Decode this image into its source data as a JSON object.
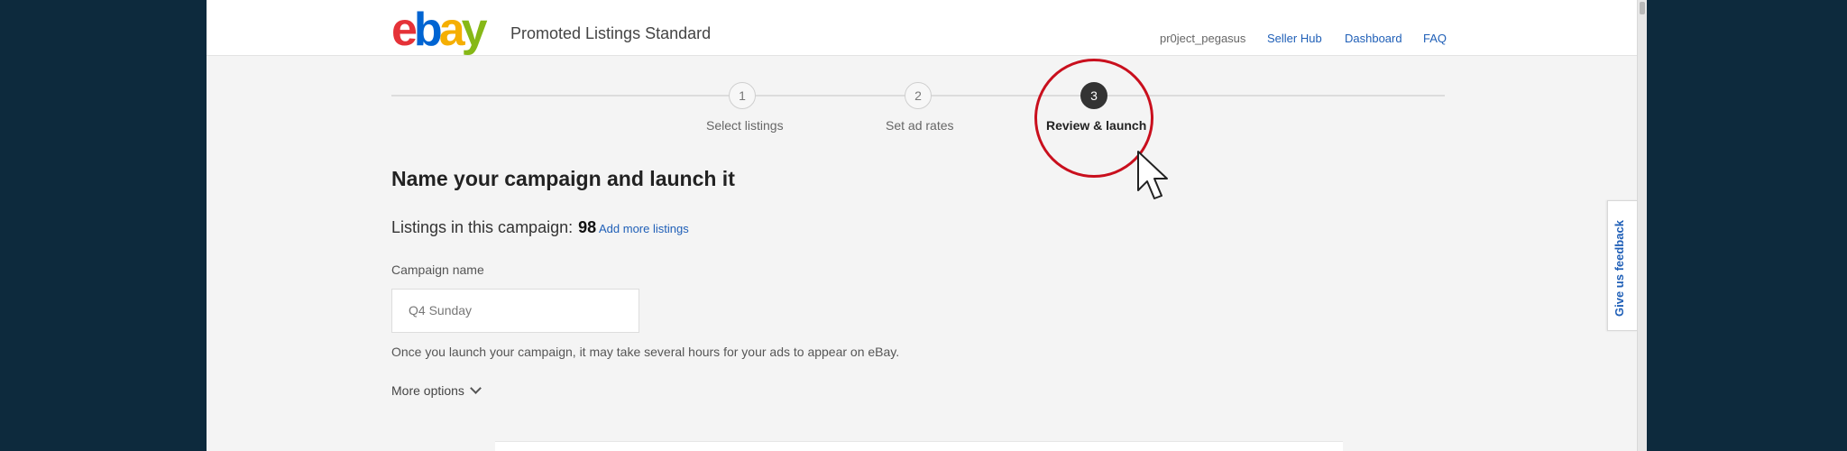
{
  "header": {
    "logo_letters": [
      "e",
      "b",
      "a",
      "y"
    ],
    "logo_colors": [
      "#e53238",
      "#0064d2",
      "#f5af02",
      "#86b817"
    ],
    "product_title": "Promoted Listings Standard",
    "username": "pr0ject_pegasus",
    "nav": [
      "Seller Hub",
      "Dashboard",
      "FAQ"
    ]
  },
  "stepper": {
    "steps": [
      {
        "number": "1",
        "label": "Select listings",
        "state": "inactive"
      },
      {
        "number": "2",
        "label": "Set ad rates",
        "state": "inactive"
      },
      {
        "number": "3",
        "label": "Review & launch",
        "state": "active"
      }
    ],
    "highlight_color": "#c90f1d"
  },
  "main": {
    "heading": "Name your campaign and launch it",
    "listings_label": "Listings in this campaign:",
    "listings_count": "98",
    "add_more_label": "Add more listings",
    "campaign_name_label": "Campaign name",
    "campaign_name_value": "Q4 Sunday",
    "notice": "Once you launch your campaign, it may take several hours for your ads to appear on eBay.",
    "more_options_label": "More options"
  },
  "feedback": {
    "label": "Give us feedback"
  }
}
